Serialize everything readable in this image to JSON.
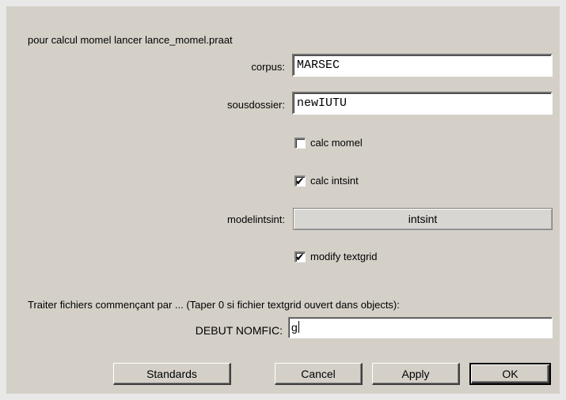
{
  "dialog": {
    "intro_text": "pour calcul momel lancer lance_momel.praat",
    "corpus": {
      "label": "corpus:",
      "value": "MARSEC"
    },
    "sousdossier": {
      "label": "sousdossier:",
      "value": "newIUTU"
    },
    "calc_momel": {
      "label": "calc momel",
      "checked": false
    },
    "calc_intsint": {
      "label": "calc intsint",
      "checked": true,
      "mark": "✔"
    },
    "modelintsint": {
      "label": "modelintsint:",
      "button_label": "intsint"
    },
    "modify_textgrid": {
      "label": "modify textgrid",
      "checked": true,
      "mark": "✔"
    },
    "prefix_text": "Traiter fichiers commençant par ... (Taper 0 si fichier textgrid ouvert dans objects):",
    "debut_nomfic": {
      "label": "DEBUT NOMFIC:",
      "value": "g"
    },
    "buttons": {
      "standards": "Standards",
      "cancel": "Cancel",
      "apply": "Apply",
      "ok": "OK"
    }
  },
  "colors": {
    "dialog_background": "#d4d0c8",
    "field_background": "#ffffff",
    "text": "#000000"
  }
}
